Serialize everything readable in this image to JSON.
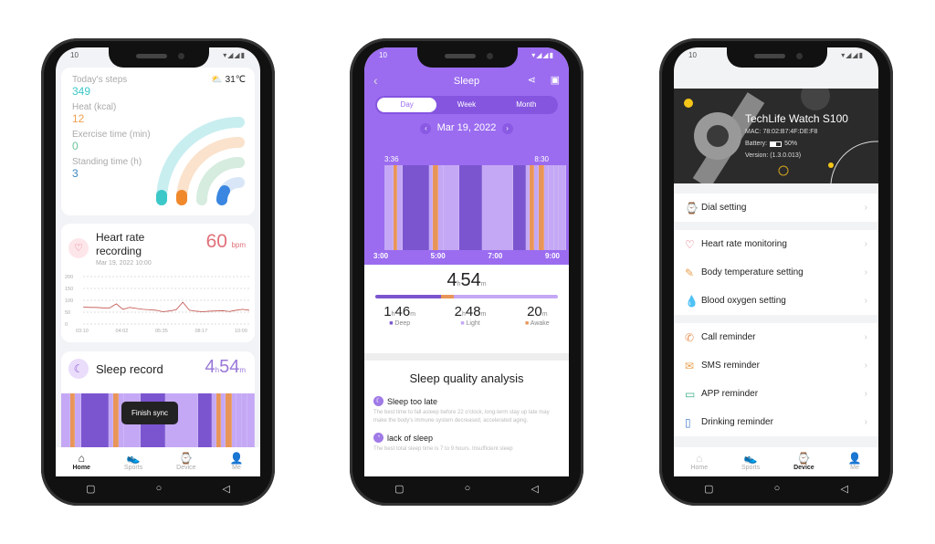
{
  "status": {
    "time": "10",
    "icons": "▾◢◢▮"
  },
  "home": {
    "steps_label": "Today's steps",
    "steps": "349",
    "heat_label": "Heat (kcal)",
    "heat": "12",
    "exercise_label": "Exercise time (min)",
    "exercise": "0",
    "standing_label": "Standing time (h)",
    "standing": "3",
    "weather": "31℃",
    "colors": {
      "steps": "#3cc8c8",
      "heat": "#f0882c",
      "exercise": "#6cc49a",
      "standing": "#3a86e0"
    },
    "hr_title": "Heart rate recording",
    "hr_value": "60",
    "hr_unit": "bpm",
    "hr_date": "Mar 19, 2022 10:00",
    "hr_chart": {
      "type": "line",
      "y_ticks": [
        "200",
        "150",
        "100",
        "50",
        "0"
      ],
      "x_ticks": [
        "03:10",
        "04:02",
        "05:35",
        "08:17",
        "10:00"
      ],
      "ylim": [
        0,
        200
      ],
      "values": [
        72,
        70,
        70,
        68,
        68,
        85,
        62,
        70,
        66,
        62,
        60,
        58,
        52,
        55,
        60,
        92,
        58,
        54,
        52,
        54,
        55,
        56,
        53,
        58,
        62,
        58
      ]
    },
    "sleep_title": "Sleep record",
    "sleep_h": "4",
    "sleep_m": "54",
    "h": "h",
    "m": "m",
    "toast": "Finish sync",
    "tabs": [
      "Home",
      "Sports",
      "Device",
      "Me"
    ]
  },
  "sleep": {
    "title": "Sleep",
    "periods": [
      "Day",
      "Week",
      "Month"
    ],
    "date": "Mar 19, 2022",
    "start": "3:36",
    "end": "8:30",
    "x_ticks": [
      "3:00",
      "5:00",
      "7:00",
      "9:00"
    ],
    "segments": [
      [
        "light",
        10
      ],
      [
        "awake",
        4
      ],
      [
        "light",
        6
      ],
      [
        "deep",
        32
      ],
      [
        "light",
        4
      ],
      [
        "awake",
        5
      ],
      [
        "light",
        6
      ],
      [
        "light",
        18
      ],
      [
        "deep",
        28
      ],
      [
        "light",
        38
      ],
      [
        "deep",
        15
      ],
      [
        "light",
        4
      ],
      [
        "awake",
        5
      ],
      [
        "light",
        4
      ],
      [
        "awake",
        6
      ],
      [
        "light",
        5
      ],
      [
        "light",
        5
      ],
      [
        "light",
        5
      ],
      [
        "light",
        8
      ]
    ],
    "total_h": "4",
    "total_m": "54",
    "deep_h": "1",
    "deep_m": "46",
    "deep_label": "Deep",
    "light_h": "2",
    "light_m": "48",
    "light_label": "Light",
    "awake_m": "20",
    "awake_label": "Awake",
    "colors": {
      "deep": "#7b55cf",
      "light": "#c4a8f5",
      "awake": "#e8955a",
      "header": "#9b6cf0"
    },
    "analysis_title": "Sleep quality analysis",
    "items": [
      {
        "title": "Sleep too late",
        "text": "The best time to fall asleep before 22 o'clock, long-term stay up late may make the body's immune system decreased, accelerated aging."
      },
      {
        "title": "lack of sleep",
        "text": "The best total sleep time is 7 to 9 hours. Insufficient sleep"
      }
    ]
  },
  "device": {
    "name": "TechLife Watch S100",
    "mac": "MAC: 78:02:B7:4F:DE:F8",
    "battery_label": "Battery:",
    "battery": "50%",
    "version": "Version: (1.3.0.013)",
    "battery_level": 0.5,
    "groups": [
      [
        {
          "label": "Dial setting",
          "icon": "watch-icon"
        }
      ],
      [
        {
          "label": "Heart rate monitoring",
          "icon": "heart-rate-icon"
        },
        {
          "label": "Body temperature setting",
          "icon": "thermometer-icon"
        },
        {
          "label": "Blood oxygen setting",
          "icon": "droplet-icon"
        }
      ],
      [
        {
          "label": "Call reminder",
          "icon": "phone-icon"
        },
        {
          "label": "SMS reminder",
          "icon": "envelope-icon"
        },
        {
          "label": "APP reminder",
          "icon": "tablet-icon"
        },
        {
          "label": "Drinking reminder",
          "icon": "cup-icon"
        }
      ]
    ]
  }
}
